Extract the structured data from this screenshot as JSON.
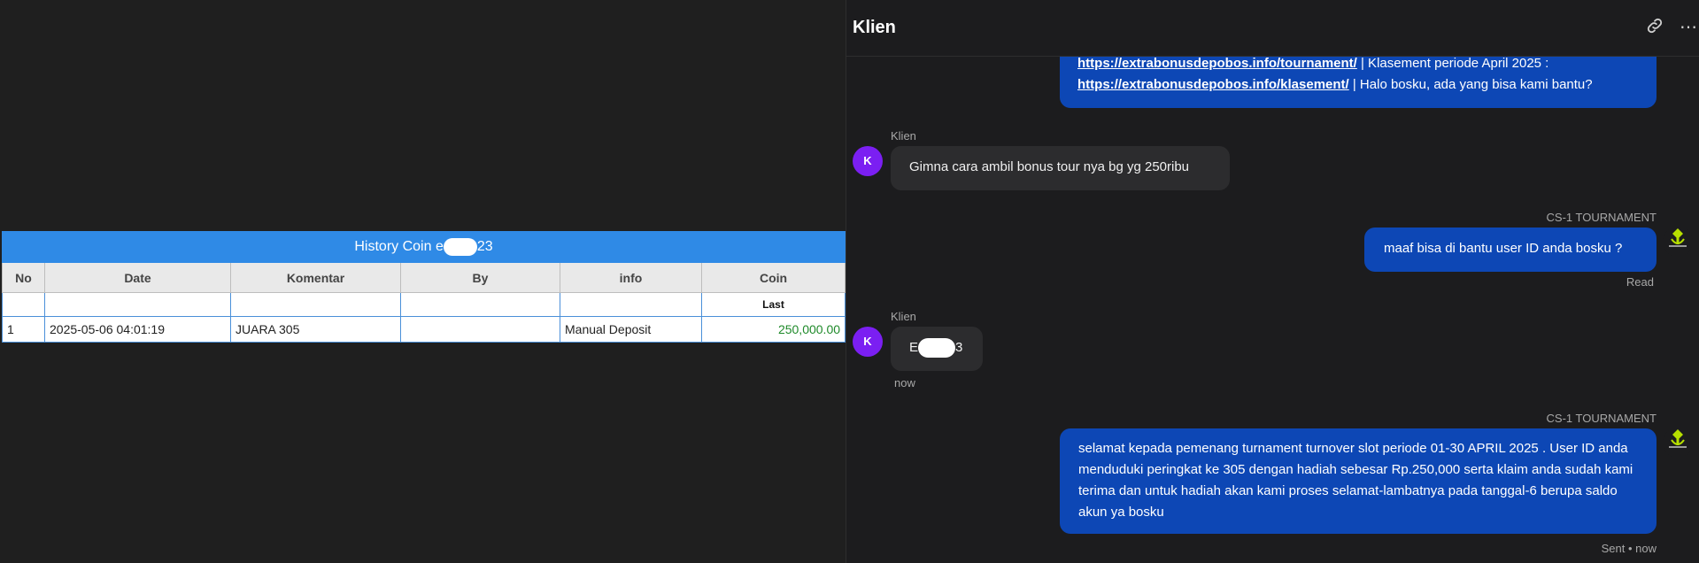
{
  "history": {
    "title_prefix": "History Coin e",
    "title_suffix": "23",
    "columns": [
      "No",
      "Date",
      "Komentar",
      "By",
      "info",
      "Coin"
    ],
    "sub_label": "Last",
    "rows": [
      {
        "no": "1",
        "date": "2025-05-06 04:01:19",
        "komentar": "JUARA 305",
        "by": "",
        "info": "Manual Deposit",
        "coin": "250,000.00"
      }
    ]
  },
  "chat": {
    "title": "Klien",
    "icons": {
      "link": "link-icon",
      "more": "more-icon"
    },
    "messages": {
      "m1": {
        "link1": "https://extrabonusdepobos.info/tournament/",
        "text1": " | Klasement periode April 2025 :",
        "link2": "https://extrabonusdepobos.info/klasement/",
        "text2": " | Halo bosku, ada yang bisa kami bantu?"
      },
      "m2": {
        "sender": "Klien",
        "avatar": "K",
        "text": "Gimna cara ambil bonus tour nya bg yg 250ribu"
      },
      "m3": {
        "sender": "CS-1 TOURNAMENT",
        "text": "maaf bisa di bantu user ID anda bosku ?",
        "status": "Read"
      },
      "m4": {
        "sender": "Klien",
        "avatar": "K",
        "text_prefix": "E",
        "text_suffix": "3",
        "time": "now"
      },
      "m5": {
        "sender": "CS-1 TOURNAMENT",
        "text": "selamat kepada pemenang turnament turnover slot periode 01-30 APRIL 2025 . User ID anda menduduki peringkat ke 305 dengan hadiah sebesar Rp.250,000 serta klaim anda sudah kami terima dan untuk hadiah akan kami proses selamat-lambatnya pada tanggal-6 berupa saldo akun ya bosku",
        "status": "Sent • now"
      }
    }
  },
  "colors": {
    "agent_bubble": "#0d47b5",
    "client_bubble": "#2c2c2e",
    "avatar": "#7b1ff2",
    "table_header": "#2f8ae6"
  }
}
